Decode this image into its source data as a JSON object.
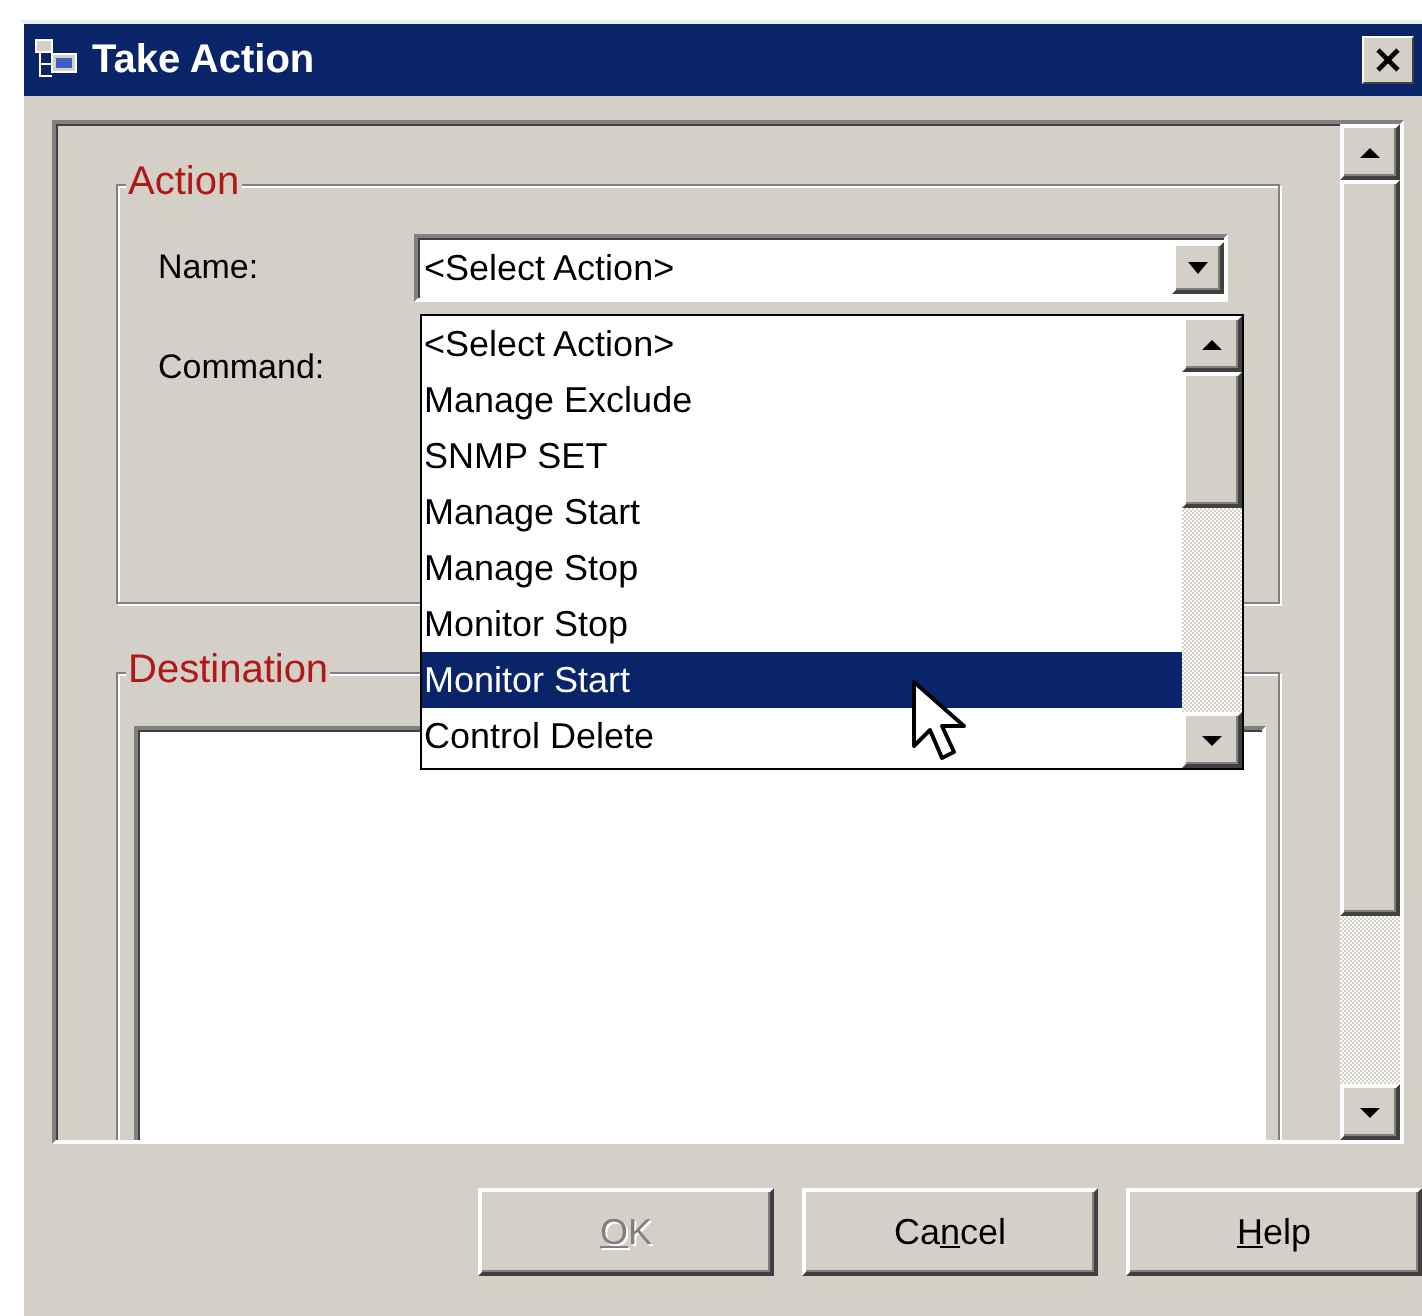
{
  "window": {
    "title": "Take Action"
  },
  "action_group": {
    "legend": "Action",
    "name_label": "Name:",
    "name_value": "<Select Action>",
    "command_label": "Command:"
  },
  "destination_group": {
    "legend": "Destination"
  },
  "dropdown": {
    "items": [
      {
        "label": "<Select Action>",
        "selected": false
      },
      {
        "label": "Manage Exclude",
        "selected": false
      },
      {
        "label": "SNMP SET",
        "selected": false
      },
      {
        "label": "Manage Start",
        "selected": false
      },
      {
        "label": "Manage Stop",
        "selected": false
      },
      {
        "label": "Monitor Stop",
        "selected": false
      },
      {
        "label": "Monitor Start",
        "selected": true
      },
      {
        "label": "Control Delete",
        "selected": false
      }
    ]
  },
  "buttons": [
    {
      "key": "O",
      "after": "K",
      "disabled": true
    },
    {
      "before": "Ca",
      "key": "n",
      "after": "cel",
      "disabled": false
    },
    {
      "key": "H",
      "after": "elp",
      "disabled": false
    }
  ]
}
